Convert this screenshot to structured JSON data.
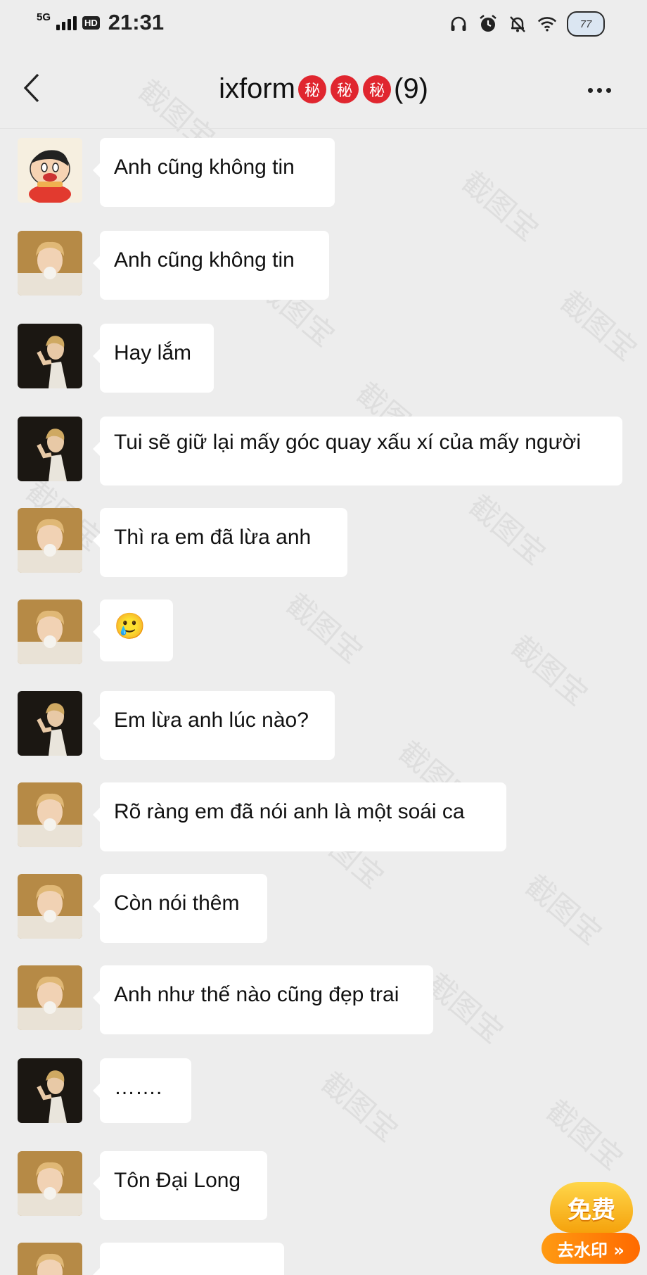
{
  "status_bar": {
    "network": "5G",
    "hd_badge": "HD",
    "time": "21:31",
    "battery_level": "77",
    "icons": [
      "headphones-icon",
      "alarm-icon",
      "mute-icon",
      "wifi-icon",
      "battery-icon"
    ]
  },
  "header": {
    "title": "ixform",
    "title_badges": [
      "秘",
      "秘",
      "秘"
    ],
    "member_count": "(9)",
    "back_icon": "chevron-left-icon",
    "more_icon": "more-dots-icon"
  },
  "messages": [
    {
      "avatar": "cartoon-boy",
      "text": "Anh cũng không tin"
    },
    {
      "avatar": "blond-bubble",
      "text": "Anh cũng không tin"
    },
    {
      "avatar": "dark-portrait",
      "text": "Hay lắm"
    },
    {
      "avatar": "dark-portrait",
      "text": "Tui sẽ giữ lại mấy góc quay xấu xí của mấy người"
    },
    {
      "avatar": "blond-bubble",
      "text": "Thì ra em đã lừa anh"
    },
    {
      "avatar": "blond-bubble",
      "text": "🥲"
    },
    {
      "avatar": "dark-portrait",
      "text": "Em lừa anh lúc nào?"
    },
    {
      "avatar": "blond-bubble",
      "text": "Rõ ràng em đã nói anh là một soái ca"
    },
    {
      "avatar": "blond-bubble",
      "text": "Còn nói thêm"
    },
    {
      "avatar": "blond-bubble",
      "text": "Anh như thế nào cũng đẹp trai"
    },
    {
      "avatar": "dark-portrait",
      "text": "……."
    },
    {
      "avatar": "blond-bubble",
      "text": "Tôn Đại Long"
    },
    {
      "avatar": "blond-bubble",
      "text": ""
    }
  ],
  "watermark_text": "截图宝",
  "free_badge": {
    "top": "免费",
    "bottom": "去水印 »"
  }
}
